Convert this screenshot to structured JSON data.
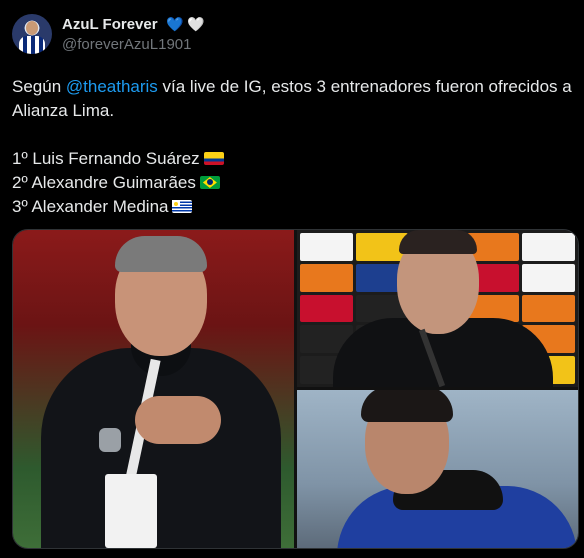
{
  "author": {
    "display_name": "AzuL Forever",
    "hearts": [
      "💙",
      "🤍"
    ],
    "handle": "@foreverAzuL1901",
    "avatar": "profile-avatar"
  },
  "tweet": {
    "intro_prefix": "Según ",
    "mention": "@theatharis",
    "intro_suffix": " vía live de IG, estos 3 entrenadores fueron ofrecidos a Alianza Lima.",
    "items": [
      {
        "text": "1º Luis Fernando Suárez",
        "flag": "flag-colombia"
      },
      {
        "text": "2º Alexandre Guimarães",
        "flag": "flag-brazil"
      },
      {
        "text": "3º Alexander Medina",
        "flag": "flag-uruguay"
      }
    ]
  },
  "media": {
    "images": [
      "photo-luis-fernando-suarez",
      "photo-alexandre-guimaraes",
      "photo-alexander-medina"
    ]
  }
}
